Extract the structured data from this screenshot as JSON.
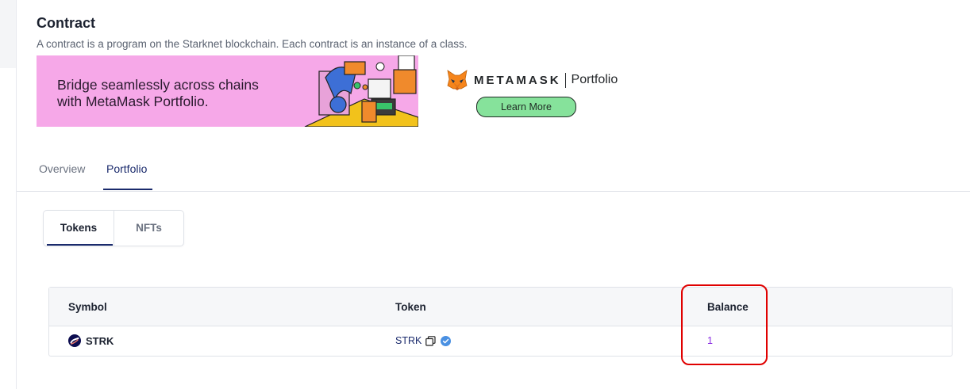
{
  "contract": {
    "title": "Contract",
    "subtitle": "A contract is a program on the Starknet blockchain. Each contract is an instance of a class."
  },
  "ad": {
    "headline_line1": "Bridge seamlessly across chains",
    "headline_line2": "with MetaMask Portfolio.",
    "brand": "METAMASK",
    "product": "Portfolio",
    "cta": "Learn More",
    "bg_color": "#f6a8e8",
    "cta_color": "#86e29b"
  },
  "tabs": [
    {
      "label": "Overview",
      "active": false
    },
    {
      "label": "Portfolio",
      "active": true
    }
  ],
  "segments": [
    {
      "label": "Tokens",
      "active": true
    },
    {
      "label": "NFTs",
      "active": false
    }
  ],
  "table": {
    "headers": [
      "Symbol",
      "Token",
      "Balance"
    ],
    "rows": [
      {
        "symbol": "STRK",
        "token": "STRK",
        "verified": true,
        "balance": "1"
      }
    ]
  },
  "colors": {
    "accent": "#1a2a6c",
    "balance": "#8a2be2",
    "annotation": "#e00000",
    "verified": "#4a90e2"
  }
}
